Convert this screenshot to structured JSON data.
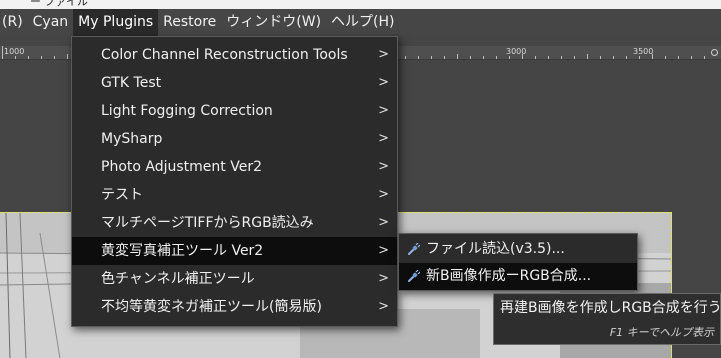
{
  "window": {
    "title_partial": "ー ファイル"
  },
  "menubar": {
    "items": [
      {
        "label": "(R)"
      },
      {
        "label": "Cyan"
      },
      {
        "label": "My Plugins"
      },
      {
        "label": "Restore"
      },
      {
        "label": "ウィンドウ(W)"
      },
      {
        "label": "ヘルプ(H)"
      }
    ]
  },
  "ruler": {
    "labels": [
      "1000",
      "3000",
      "3500"
    ]
  },
  "plugins_menu": {
    "items": [
      {
        "label": "Color Channel Reconstruction Tools",
        "has_submenu": true
      },
      {
        "label": "GTK Test",
        "has_submenu": true
      },
      {
        "label": "Light Fogging Correction",
        "has_submenu": true
      },
      {
        "label": "MySharp",
        "has_submenu": true
      },
      {
        "label": "Photo Adjustment Ver2",
        "has_submenu": true
      },
      {
        "label": "テスト",
        "has_submenu": true
      },
      {
        "label": "マルチページTIFFからRGB読込み",
        "has_submenu": true
      },
      {
        "label": "黄変写真補正ツール Ver2",
        "has_submenu": true
      },
      {
        "label": "色チャンネル補正ツール",
        "has_submenu": true
      },
      {
        "label": "不均等黄変ネガ補正ツール(簡易版)",
        "has_submenu": true
      }
    ],
    "arrow_glyph": ">"
  },
  "submenu": {
    "items": [
      {
        "label": "ファイル読込(v3.5)...",
        "icon": "plugin-icon"
      },
      {
        "label": "新B画像作成ーRGB合成...",
        "icon": "plugin-icon"
      }
    ]
  },
  "tooltip": {
    "text": "再建B画像を作成しRGB合成を行う",
    "help": "F1 キーでヘルプ表示"
  },
  "colors": {
    "menubar_bg": "#464646",
    "menu_bg": "#2b2b2b",
    "highlight_bg": "#0d0d0d",
    "selection_outline": "#e6e63a"
  }
}
